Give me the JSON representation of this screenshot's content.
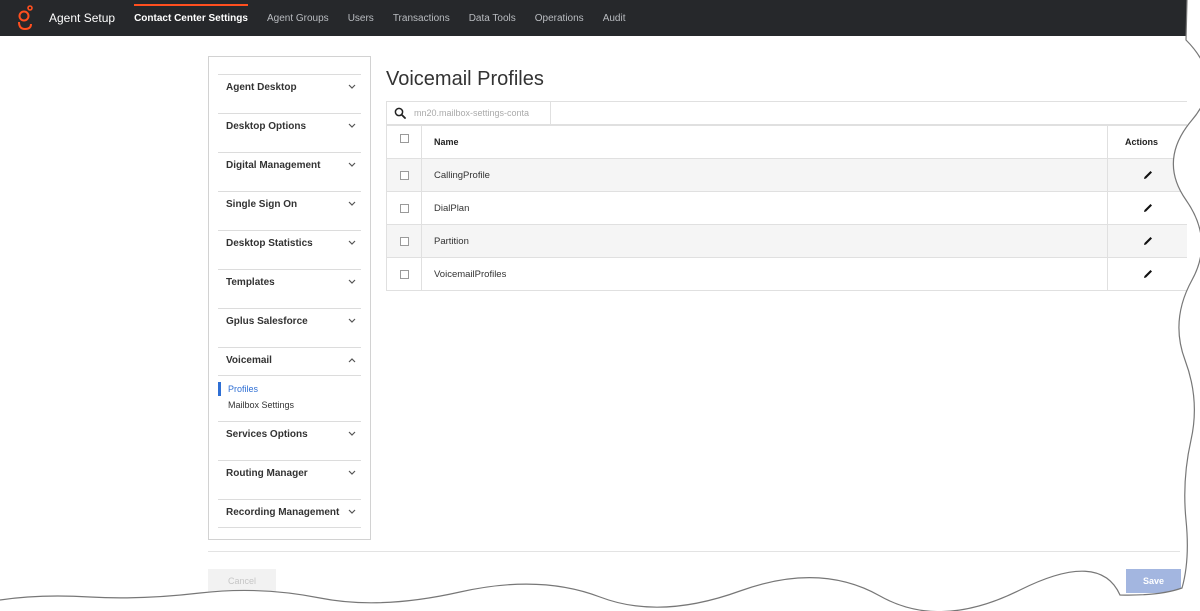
{
  "app": {
    "title": "Agent Setup",
    "logo_icon": "genesys-logo-icon",
    "accent_color": "#ff4f1f"
  },
  "nav": {
    "tabs": [
      {
        "label": "Contact Center Settings",
        "active": true
      },
      {
        "label": "Agent Groups",
        "active": false
      },
      {
        "label": "Users",
        "active": false
      },
      {
        "label": "Transactions",
        "active": false
      },
      {
        "label": "Data Tools",
        "active": false
      },
      {
        "label": "Operations",
        "active": false
      },
      {
        "label": "Audit",
        "active": false
      }
    ]
  },
  "sidebar": {
    "sections": [
      {
        "label": "Agent Desktop",
        "expanded": false
      },
      {
        "label": "Desktop Options",
        "expanded": false
      },
      {
        "label": "Digital Management",
        "expanded": false
      },
      {
        "label": "Single Sign On",
        "expanded": false
      },
      {
        "label": "Desktop Statistics",
        "expanded": false
      },
      {
        "label": "Templates",
        "expanded": false
      },
      {
        "label": "Gplus Salesforce",
        "expanded": false
      },
      {
        "label": "Voicemail",
        "expanded": true
      },
      {
        "label": "Services Options",
        "expanded": false
      },
      {
        "label": "Routing Manager",
        "expanded": false
      },
      {
        "label": "Recording Management",
        "expanded": false
      }
    ],
    "voicemail_items": [
      {
        "label": "Profiles",
        "active": true
      },
      {
        "label": "Mailbox Settings",
        "active": false
      }
    ],
    "chevron_down": "⌄",
    "chevron_up": "^"
  },
  "main": {
    "title": "Voicemail Profiles",
    "search": {
      "placeholder": "mn20.mailbox-settings-conta"
    },
    "table": {
      "columns": [
        "Name",
        "Actions"
      ],
      "rows": [
        {
          "name": "CallingProfile"
        },
        {
          "name": "DialPlan"
        },
        {
          "name": "Partition"
        },
        {
          "name": "VoicemailProfiles"
        }
      ]
    }
  },
  "footer": {
    "cancel_label": "Cancel",
    "save_label": "Save"
  }
}
